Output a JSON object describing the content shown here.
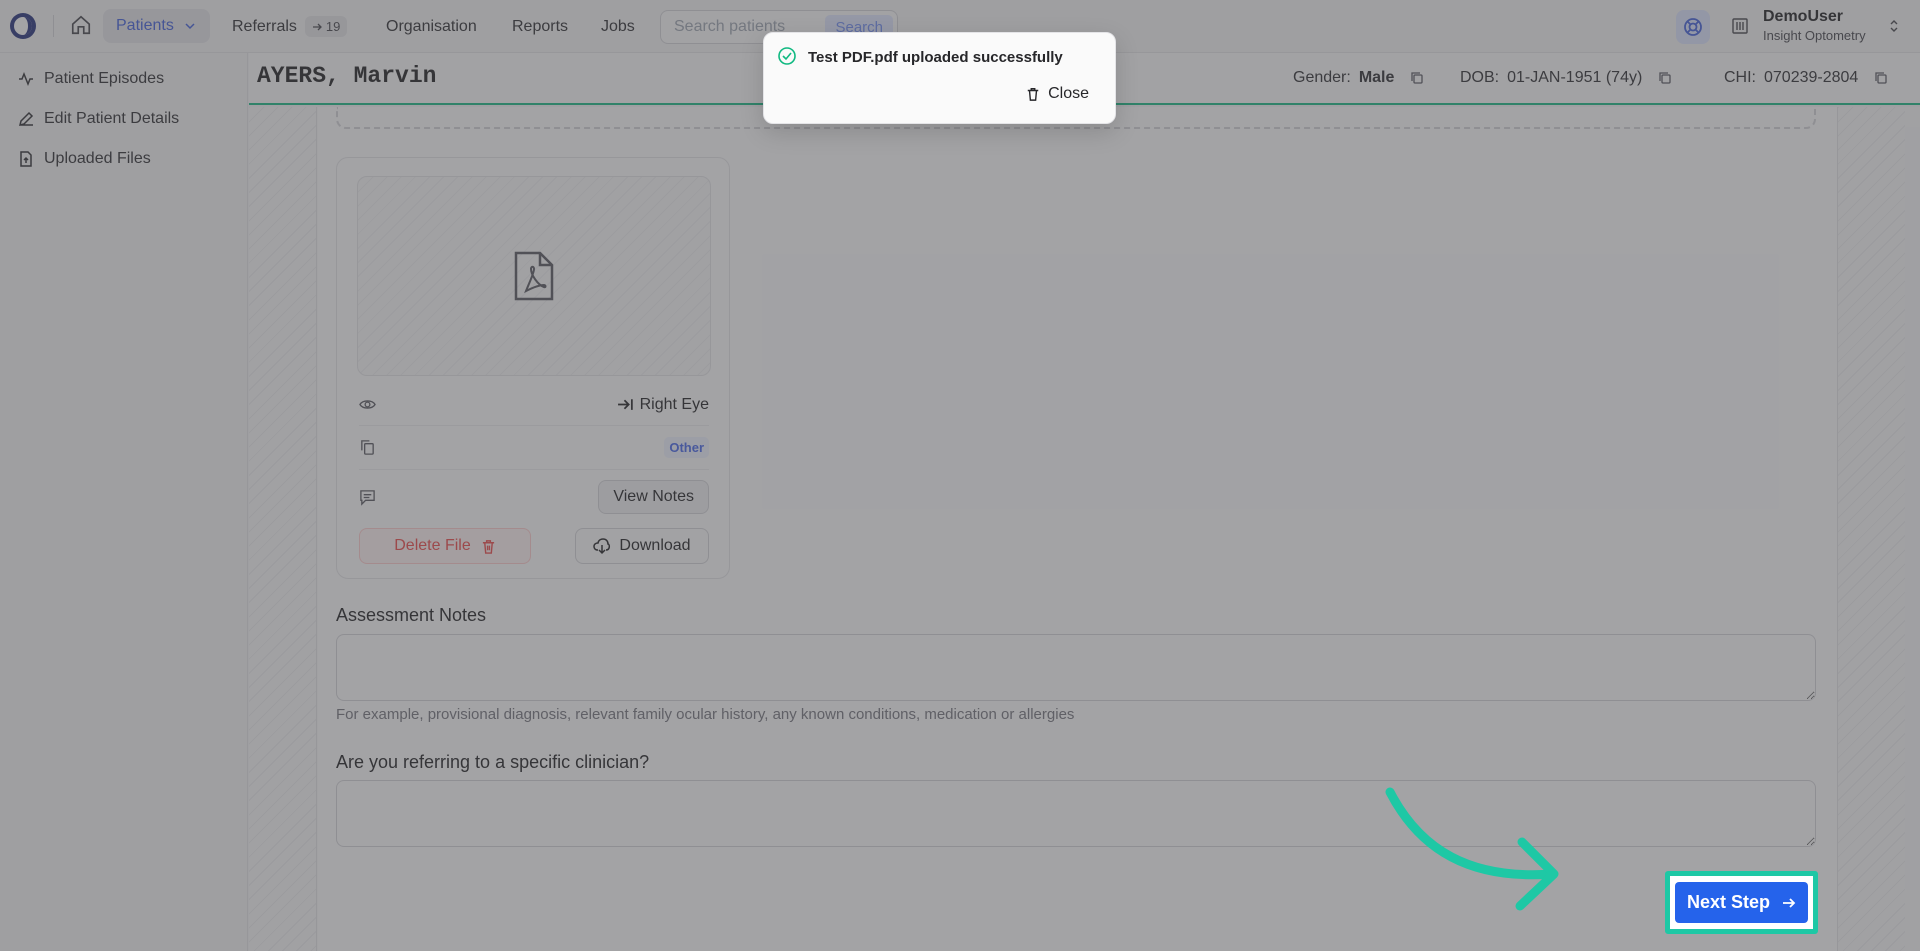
{
  "nav": {
    "patients": "Patients",
    "referrals": "Referrals",
    "referrals_badge": "19",
    "organisation": "Organisation",
    "reports": "Reports",
    "jobs": "Jobs",
    "search_placeholder": "Search patients",
    "search_button": "Search"
  },
  "user": {
    "name": "DemoUser",
    "org": "Insight Optometry"
  },
  "sidebar": {
    "items": [
      {
        "label": "Patient Episodes"
      },
      {
        "label": "Edit Patient Details"
      },
      {
        "label": "Uploaded Files"
      }
    ]
  },
  "patient": {
    "name": "AYERS, Marvin",
    "gender_label": "Gender:",
    "gender": "Male",
    "dob_label": "DOB:",
    "dob": "01-JAN-1951 (74y)",
    "chi_label": "CHI:",
    "chi": "070239-2804"
  },
  "file_card": {
    "eye": "Right Eye",
    "type": "Other",
    "view_notes": "View Notes",
    "delete": "Delete File",
    "download": "Download"
  },
  "form": {
    "assessment_label": "Assessment Notes",
    "assessment_help": "For example, provisional diagnosis, relevant family ocular history, any known conditions, medication or allergies",
    "clinician_label": "Are you referring to a specific clinician?"
  },
  "toast": {
    "message": "Test PDF.pdf uploaded successfully",
    "close": "Close"
  },
  "next_step": "Next Step",
  "colors": {
    "accent": "#2563eb",
    "success": "#10b981",
    "highlight": "#1ec8a5",
    "danger": "#ef4444"
  }
}
